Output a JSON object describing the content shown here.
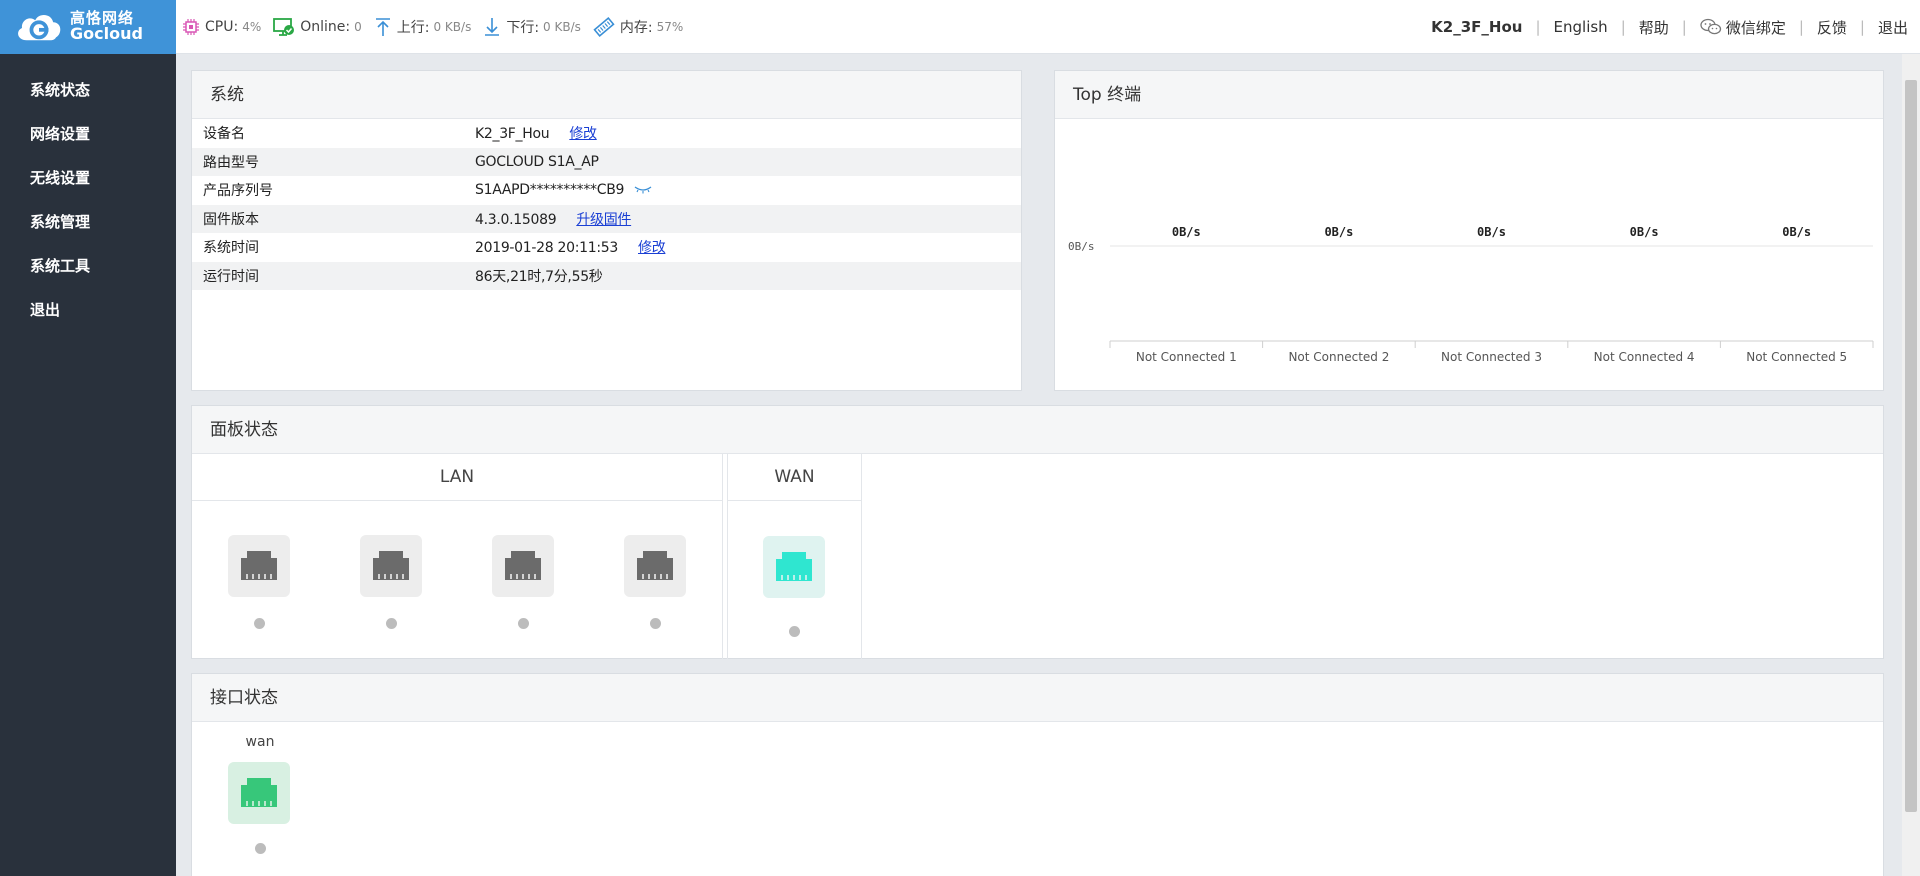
{
  "brand": {
    "name_cn": "高恪网络",
    "name_en": "Gocloud"
  },
  "status_bar": {
    "cpu_label": "CPU:",
    "cpu_value": "4%",
    "online_label": "Online:",
    "online_value": "0",
    "up_label": "上行:",
    "up_value": "0 KB/s",
    "down_label": "下行:",
    "down_value": "0 KB/s",
    "mem_label": "内存:",
    "mem_value": "57%"
  },
  "top_menu": {
    "device": "K2_3F_Hou",
    "language": "English",
    "help": "帮助",
    "wechat": "微信绑定",
    "feedback": "反馈",
    "logout": "退出"
  },
  "sidebar": {
    "items": [
      {
        "label": "系统状态"
      },
      {
        "label": "网络设置"
      },
      {
        "label": "无线设置"
      },
      {
        "label": "系统管理"
      },
      {
        "label": "系统工具"
      },
      {
        "label": "退出"
      }
    ]
  },
  "system_panel": {
    "title": "系统",
    "rows": [
      {
        "key": "设备名",
        "value": "K2_3F_Hou",
        "action": "修改"
      },
      {
        "key": "路由型号",
        "value": "GOCLOUD S1A_AP",
        "action": ""
      },
      {
        "key": "产品序列号",
        "value": "S1AAPD**********CB9",
        "action": ""
      },
      {
        "key": "固件版本",
        "value": "4.3.0.15089",
        "action": "升级固件"
      },
      {
        "key": "系统时间",
        "value": "2019-01-28 20:11:53",
        "action": "修改"
      },
      {
        "key": "运行时间",
        "value": "86天,21时,7分,55秒",
        "action": ""
      }
    ]
  },
  "top_panel": {
    "title": "Top 终端",
    "chart_data": {
      "type": "bar",
      "categories": [
        "Not Connected 1",
        "Not Connected 2",
        "Not Connected 3",
        "Not Connected 4",
        "Not Connected 5"
      ],
      "values": [
        0,
        0,
        0,
        0,
        0
      ],
      "value_labels": [
        "0B/s",
        "0B/s",
        "0B/s",
        "0B/s",
        "0B/s"
      ],
      "y_ticks": [
        "0B/s"
      ],
      "grid": true
    }
  },
  "panel_status": {
    "title": "面板状态",
    "lan_label": "LAN",
    "wan_label": "WAN",
    "lan_ports": [
      {
        "state": "off"
      },
      {
        "state": "off"
      },
      {
        "state": "off"
      },
      {
        "state": "off"
      }
    ],
    "wan_port": {
      "state": "on"
    },
    "colors": {
      "port_off": "#6b6b6b",
      "port_wan": "#2fe6d0",
      "port_up": "#37c77a",
      "dot": "#bcbcbc"
    }
  },
  "interface_status": {
    "title": "接口状态",
    "interfaces": [
      {
        "name": "wan",
        "state": "up"
      }
    ]
  }
}
